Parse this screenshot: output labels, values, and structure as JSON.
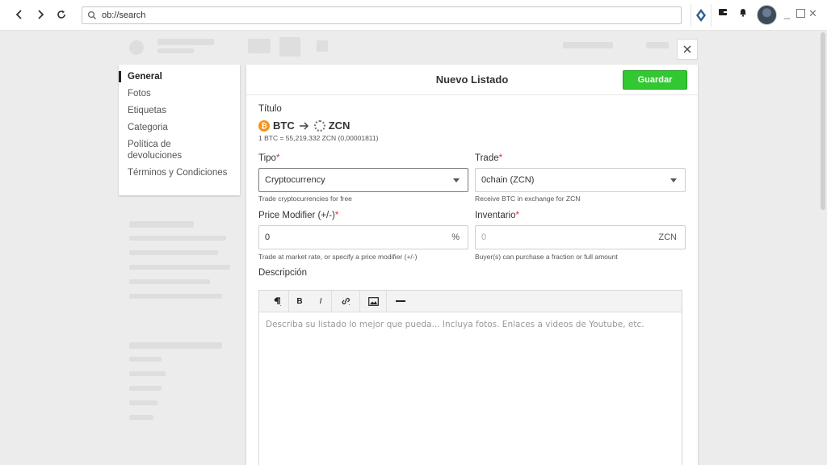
{
  "browser": {
    "url": "ob://search",
    "icons": [
      "back-icon",
      "forward-icon",
      "reload-icon",
      "search-icon",
      "openbazaar-logo-icon",
      "wallet-icon",
      "notifications-icon",
      "avatar",
      "minimize-icon",
      "maximize-icon",
      "close-window-icon"
    ]
  },
  "sidebar": {
    "items": [
      {
        "label": "General",
        "active": true
      },
      {
        "label": "Fotos"
      },
      {
        "label": "Etiquetas"
      },
      {
        "label": "Categoria"
      },
      {
        "label": "Política de\ndevoluciones"
      },
      {
        "label": "Términos y Condiciones"
      }
    ]
  },
  "panel": {
    "title": "Nuevo Listado",
    "save_label": "Guardar",
    "close_icon": "close-icon"
  },
  "form": {
    "titulo_label": "Título",
    "from_coin": "BTC",
    "to_coin": "ZCN",
    "rate": "1 BTC = 55,219,332 ZCN (0,00001811)",
    "tipo_label": "Tipo",
    "tipo_value": "Cryptocurrency",
    "tipo_hint": "Trade cryptocurrencies for free",
    "trade_label": "Trade",
    "trade_value": "0chain (ZCN)",
    "trade_hint": "Receive BTC in exchange for ZCN",
    "modifier_label": "Price Modifier (+/-)",
    "modifier_value": "0",
    "modifier_suffix": "%",
    "modifier_hint": "Trade at market rate, or specify a price modifier (+/-)",
    "inventory_label": "Inventario",
    "inventory_placeholder": "0",
    "inventory_suffix": "ZCN",
    "inventory_hint": "Buyer(s) can purchase a fraction or full amount",
    "required_mark": "*",
    "description_label": "Descripción",
    "description_placeholder": "Describa su listado lo mejor que pueda... Incluya fotos. Enlaces a videos de Youtube, etc."
  },
  "editor_toolbar": {
    "bold": "B",
    "italic": "I"
  },
  "colors": {
    "save_green": "#32c832",
    "btc_orange": "#f7931a",
    "required_red": "#e03030"
  }
}
